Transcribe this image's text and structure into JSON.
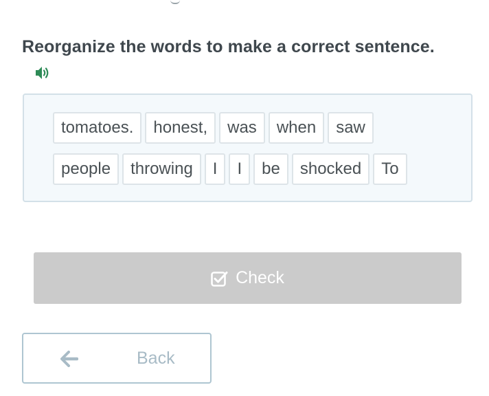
{
  "instruction": "Reorganize the words to make a correct sentence.",
  "audio_icon": "speaker-icon",
  "word_rows": [
    [
      "tomatoes.",
      "honest,",
      "was",
      "when",
      "saw"
    ],
    [
      "people",
      "throwing",
      "I",
      "I",
      "be",
      "shocked",
      "To"
    ]
  ],
  "check_button": {
    "label": "Check",
    "icon": "checkbox-icon",
    "enabled": false
  },
  "back_button": {
    "label": "Back",
    "icon": "arrow-left-icon"
  },
  "colors": {
    "title": "#3f474d",
    "audio_icon": "#2e8b57",
    "word_area_bg": "#f4f9fc",
    "word_area_border": "#d3e0e8",
    "chip_border": "#dde4e8",
    "chip_text": "#4a5155",
    "check_button_bg": "#cbcbcb",
    "back_border": "#aec5d1",
    "back_text": "#a8bbc6"
  }
}
